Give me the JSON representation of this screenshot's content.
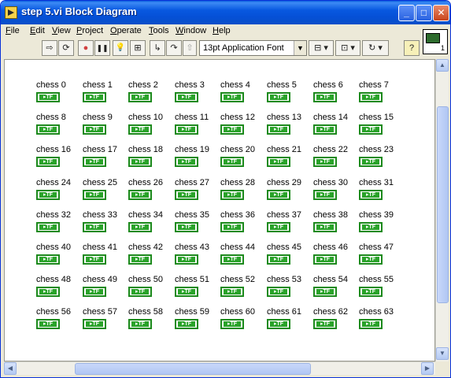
{
  "window": {
    "title": "step 5.vi Block Diagram",
    "controls": {
      "minimize": "_",
      "maximize": "□",
      "close": "✕"
    }
  },
  "menubar": {
    "items": [
      {
        "label": "File",
        "accel": "F"
      },
      {
        "label": "Edit",
        "accel": "E"
      },
      {
        "label": "View",
        "accel": "V"
      },
      {
        "label": "Project",
        "accel": "P"
      },
      {
        "label": "Operate",
        "accel": "O"
      },
      {
        "label": "Tools",
        "accel": "T"
      },
      {
        "label": "Window",
        "accel": "W"
      },
      {
        "label": "Help",
        "accel": "H"
      }
    ]
  },
  "toolbar": {
    "buttons": [
      {
        "name": "run-arrow-icon",
        "glyph": "⇨"
      },
      {
        "name": "run-continuously-icon",
        "glyph": "⟳"
      },
      {
        "name": "abort-icon",
        "glyph": "●"
      },
      {
        "name": "pause-icon",
        "glyph": "❚❚"
      },
      {
        "name": "highlight-execution-icon",
        "glyph": "💡"
      },
      {
        "name": "retain-wire-values-icon",
        "glyph": "⊞"
      },
      {
        "name": "step-into-icon",
        "glyph": "↳"
      },
      {
        "name": "step-over-icon",
        "glyph": "↷"
      },
      {
        "name": "step-out-icon",
        "glyph": "⇧"
      }
    ],
    "font_select": "13pt Application Font",
    "align_glyph": "⊟",
    "distribute_glyph": "⊡",
    "reorder_glyph": "↻",
    "help_glyph": "?",
    "vi_icon_number": "1"
  },
  "indicators": [
    "chess 0",
    "chess 1",
    "chess 2",
    "chess 3",
    "chess 4",
    "chess 5",
    "chess 6",
    "chess 7",
    "chess 8",
    "chess 9",
    "chess 10",
    "chess 11",
    "chess 12",
    "chess 13",
    "chess 14",
    "chess 15",
    "chess 16",
    "chess 17",
    "chess 18",
    "chess 19",
    "chess 20",
    "chess 21",
    "chess 22",
    "chess 23",
    "chess 24",
    "chess 25",
    "chess 26",
    "chess 27",
    "chess 28",
    "chess 29",
    "chess 30",
    "chess 31",
    "chess 32",
    "chess 33",
    "chess 34",
    "chess 35",
    "chess 36",
    "chess 37",
    "chess 38",
    "chess 39",
    "chess 40",
    "chess 41",
    "chess 42",
    "chess 43",
    "chess 44",
    "chess 45",
    "chess 46",
    "chess 47",
    "chess 48",
    "chess 49",
    "chess 50",
    "chess 51",
    "chess 52",
    "chess 53",
    "chess 54",
    "chess 55",
    "chess 56",
    "chess 57",
    "chess 58",
    "chess 59",
    "chess 60",
    "chess 61",
    "chess 62",
    "chess 63"
  ],
  "terminal_text": "TF",
  "colors": {
    "terminal_border": "#1d8a1d",
    "terminal_fill": "#2aa32a",
    "titlebar": "#0858e0"
  }
}
